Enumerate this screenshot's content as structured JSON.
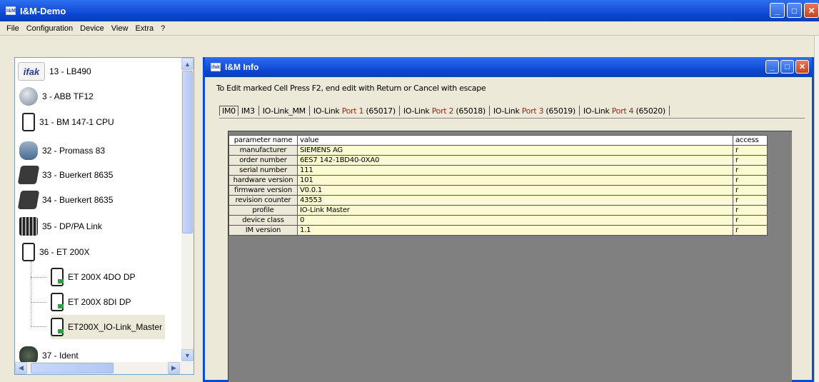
{
  "window": {
    "title": "I&M-Demo",
    "icon_text": "I&M"
  },
  "menu": [
    {
      "label": "File"
    },
    {
      "label": "Configuration"
    },
    {
      "label": "Device"
    },
    {
      "label": "View"
    },
    {
      "label": "Extra"
    },
    {
      "label": "?"
    }
  ],
  "tree": {
    "nodes": [
      {
        "label": "13 - LB490",
        "icon": "ifak-logo-icon",
        "icon_text": "ifak"
      },
      {
        "label": "3 - ABB TF12",
        "icon": "globe-device-icon"
      },
      {
        "label": "31 - BM 147-1 CPU",
        "icon": "rack-module-icon"
      },
      {
        "label": "32 - Promass 83",
        "icon": "flowmeter-icon"
      },
      {
        "label": "33 - Buerkert 8635",
        "icon": "valve-icon"
      },
      {
        "label": "34 - Buerkert 8635",
        "icon": "valve-icon"
      },
      {
        "label": "35 - DP/PA Link",
        "icon": "link-module-icon"
      },
      {
        "label": "36 - ET 200X",
        "icon": "rack-module-icon"
      },
      {
        "label": "ET 200X 4DO DP",
        "icon": "io-module-icon"
      },
      {
        "label": "ET 200X 8DI DP",
        "icon": "io-module-icon"
      },
      {
        "label": "ET200X_IO-Link_Master",
        "icon": "io-module-icon"
      },
      {
        "label": "37 - Ident",
        "icon": "ident-device-icon"
      }
    ]
  },
  "child_window": {
    "title": "I&M Info",
    "icon_text": "ifak",
    "hint": "To Edit marked Cell Press F2, end edit with Return or Cancel with escape",
    "tabs": [
      {
        "label": "IM0",
        "port": "",
        "suffix": ""
      },
      {
        "label": "IM3",
        "port": "",
        "suffix": ""
      },
      {
        "label": "IO-Link_MM",
        "port": "",
        "suffix": ""
      },
      {
        "label": "IO-Link ",
        "port": "Port 1",
        "suffix": " (65017)"
      },
      {
        "label": "IO-Link ",
        "port": "Port 2",
        "suffix": " (65018)"
      },
      {
        "label": "IO-Link ",
        "port": "Port 3",
        "suffix": " (65019)"
      },
      {
        "label": "IO-Link ",
        "port": "Port 4",
        "suffix": " (65020)"
      }
    ],
    "table": {
      "headers": {
        "name": "parameter name",
        "value": "value",
        "access": "access"
      },
      "rows": [
        {
          "name": "manufacturer",
          "value": "SIEMENS AG",
          "access": "r"
        },
        {
          "name": "order number",
          "value": "6ES7 142-1BD40-0XA0",
          "access": "r"
        },
        {
          "name": "serial number",
          "value": "111",
          "access": "r"
        },
        {
          "name": "hardware version",
          "value": "101",
          "access": "r"
        },
        {
          "name": "firmware version",
          "value": "V0.0.1",
          "access": "r"
        },
        {
          "name": "revision counter",
          "value": "43553",
          "access": "r"
        },
        {
          "name": "profile",
          "value": "IO-Link Master",
          "access": "r"
        },
        {
          "name": "device class",
          "value": "0",
          "access": "r"
        },
        {
          "name": "IM version",
          "value": "1.1",
          "access": "r"
        }
      ]
    }
  },
  "glyphs": {
    "minimize": "_",
    "maximize": "□",
    "close": "✕",
    "up": "▲",
    "down": "▼",
    "left": "◀",
    "right": "▶",
    "grip": "⋮⋮"
  }
}
